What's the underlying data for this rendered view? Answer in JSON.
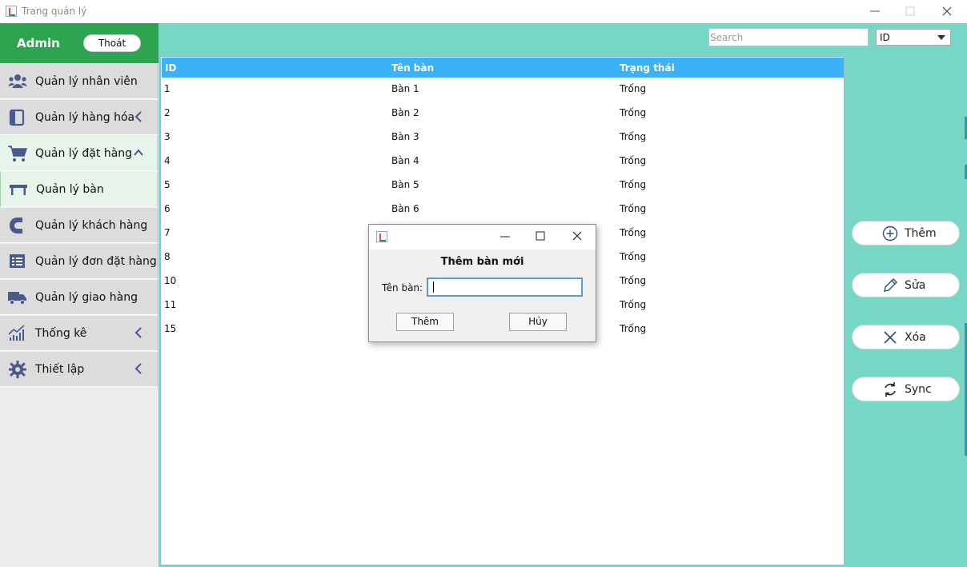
{
  "window": {
    "title": "Trang quản lý",
    "controls": [
      "minimize-icon",
      "maximize-icon",
      "close-icon"
    ]
  },
  "sidebar": {
    "user": "Admin",
    "logout_label": "Thoát",
    "accent_color": "#2ea350",
    "items": [
      {
        "label": "Quản lý nhân viên",
        "icon": "users-icon"
      },
      {
        "label": "Quản lý hàng hóa",
        "icon": "box-icon",
        "chevron": "chevron-left-icon"
      },
      {
        "label": "Quản lý đặt hàng",
        "icon": "cart-icon",
        "chevron": "chevron-up-icon",
        "expanded": true
      },
      {
        "label": "Quản lý bàn",
        "icon": "table-icon",
        "submenu": true
      },
      {
        "label": "Quản lý khách hàng",
        "icon": "customer-icon"
      },
      {
        "label": "Quản lý đơn đặt hàng",
        "icon": "order-list-icon"
      },
      {
        "label": "Quản lý giao hàng",
        "icon": "truck-icon"
      },
      {
        "label": "Thống kê",
        "icon": "chart-icon",
        "chevron": "chevron-left-icon"
      },
      {
        "label": "Thiết lập",
        "icon": "gear-icon",
        "chevron": "chevron-left-icon"
      }
    ]
  },
  "toolbar": {
    "search_placeholder": "Search",
    "filter_value": "ID"
  },
  "table": {
    "header_color": "#3bb1f7",
    "columns": [
      "ID",
      "Tên bàn",
      "Trạng thái"
    ],
    "rows": [
      [
        "1",
        "Bàn 1",
        "Trống"
      ],
      [
        "2",
        "Bàn 2",
        "Trống"
      ],
      [
        "3",
        "Bàn 3",
        "Trống"
      ],
      [
        "4",
        "Bàn 4",
        "Trống"
      ],
      [
        "5",
        "Bàn 5",
        "Trống"
      ],
      [
        "6",
        "Bàn 6",
        "Trống"
      ],
      [
        "7",
        "",
        "Trống"
      ],
      [
        "8",
        "",
        "Trống"
      ],
      [
        "10",
        "",
        "Trống"
      ],
      [
        "11",
        "",
        "Trống"
      ],
      [
        "15",
        "",
        "Trống"
      ]
    ]
  },
  "actions": [
    {
      "label": "Thêm",
      "icon": "plus-circle-icon"
    },
    {
      "label": "Sửa",
      "icon": "pencil-icon"
    },
    {
      "label": "Xóa",
      "icon": "x-icon"
    },
    {
      "label": "Sync",
      "icon": "sync-icon"
    }
  ],
  "dialog": {
    "heading": "Thêm bàn mới",
    "field_label": "Tên bàn:",
    "field_value": "",
    "confirm_label": "Thêm",
    "cancel_label": "Hủy"
  }
}
